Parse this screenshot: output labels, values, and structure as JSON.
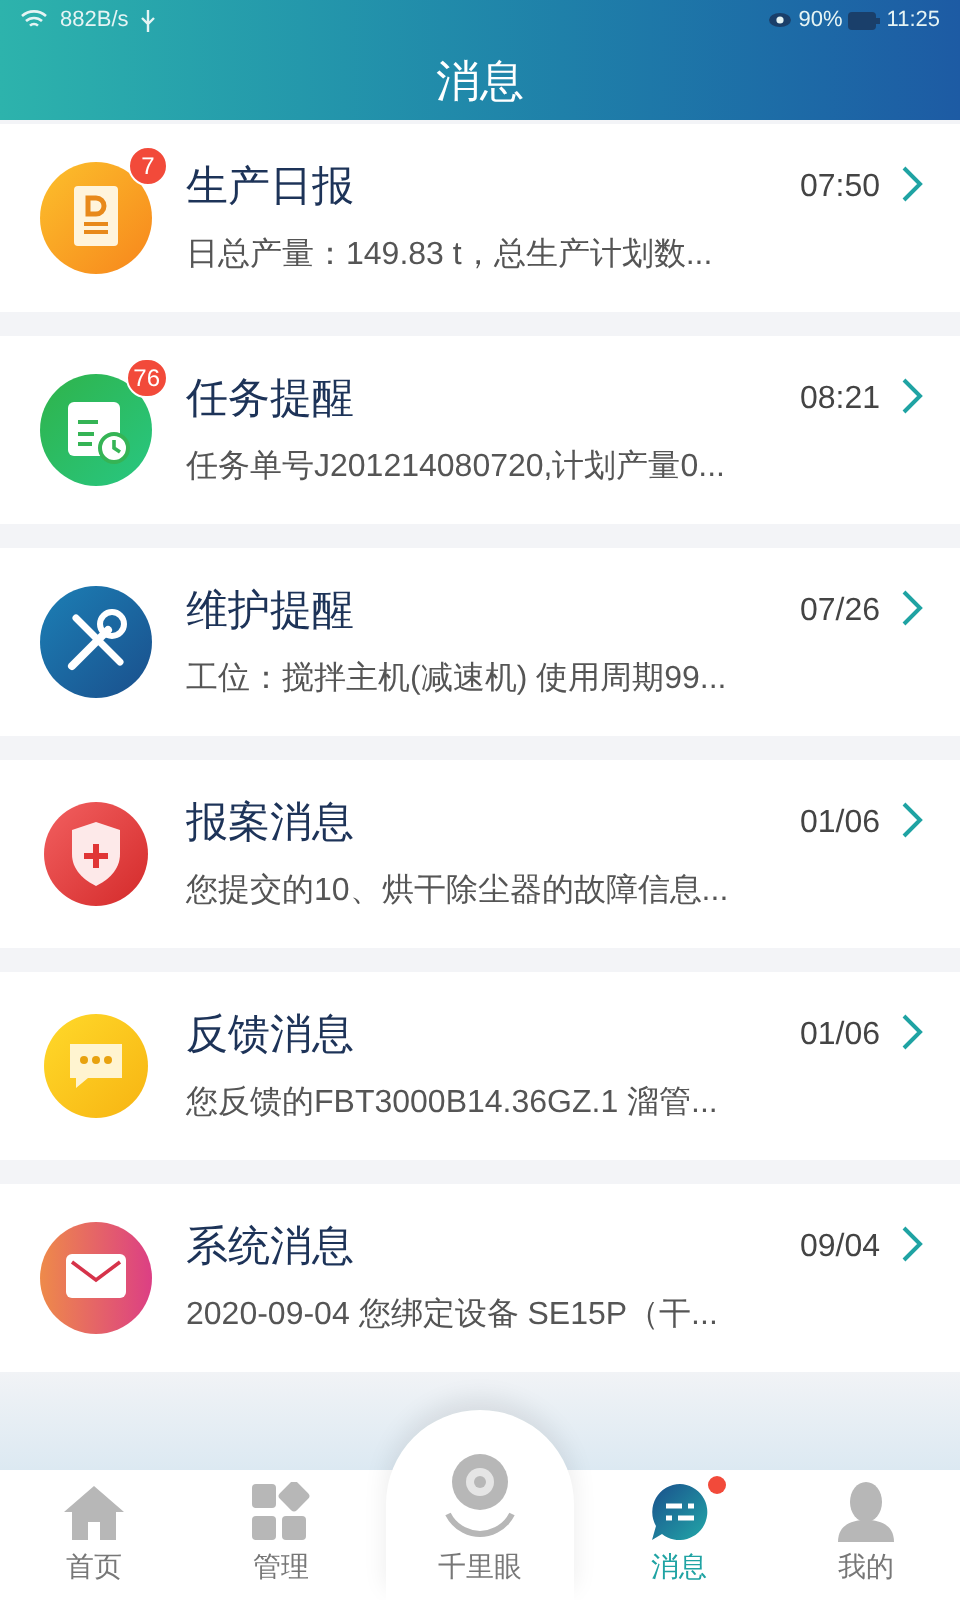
{
  "status_bar": {
    "speed": "882B/s",
    "battery": "90%",
    "time": "11:25"
  },
  "header": {
    "title": "消息"
  },
  "messages": [
    {
      "kind": "report",
      "title": "生产日报",
      "time": "07:50",
      "preview": "日总产量：149.83 t，总生产计划数...",
      "badge": "7"
    },
    {
      "kind": "task",
      "title": "任务提醒",
      "time": "08:21",
      "preview": "任务单号J201214080720,计划产量0...",
      "badge": "76"
    },
    {
      "kind": "maintenance",
      "title": "维护提醒",
      "time": "07/26",
      "preview": "工位：搅拌主机(减速机) 使用周期99..."
    },
    {
      "kind": "case",
      "title": "报案消息",
      "time": "01/06",
      "preview": "您提交的10、烘干除尘器的故障信息..."
    },
    {
      "kind": "feedback",
      "title": "反馈消息",
      "time": "01/06",
      "preview": "您反馈的FBT3000B14.36GZ.1 溜管..."
    },
    {
      "kind": "system",
      "title": "系统消息",
      "time": "09/04",
      "preview": "2020-09-04  您绑定设备 SE15P（干..."
    }
  ],
  "nav": [
    {
      "kind": "home",
      "label": "首页",
      "selected": false,
      "dot": false
    },
    {
      "kind": "manage",
      "label": "管理",
      "selected": false,
      "dot": false
    },
    {
      "kind": "camera",
      "label": "千里眼",
      "selected": false,
      "dot": false
    },
    {
      "kind": "message",
      "label": "消息",
      "selected": true,
      "dot": true
    },
    {
      "kind": "me",
      "label": "我的",
      "selected": false,
      "dot": false
    }
  ]
}
